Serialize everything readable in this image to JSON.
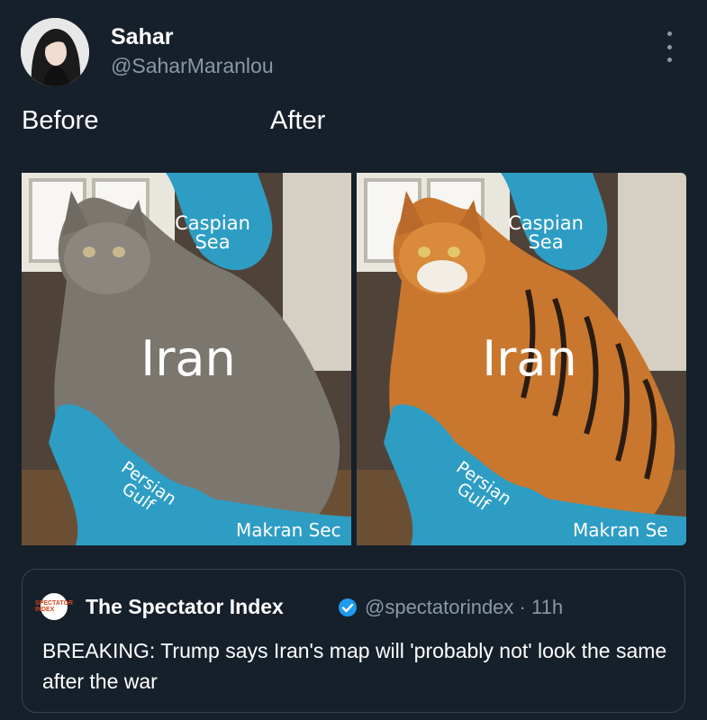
{
  "author": {
    "display_name": "Sahar",
    "handle": "@SaharMaranlou",
    "avatar_icon": "avatar-photo-icon"
  },
  "post": {
    "before_label": "Before",
    "after_label": "After",
    "more_icon": "more-vertical-icon"
  },
  "image_left": {
    "caspian": "Caspian Sea",
    "caspian_line1": "Caspian",
    "caspian_line2": "Sea",
    "country": "Iran",
    "gulf_line1": "Persian",
    "gulf_line2": "Gulf",
    "makran": "Makran Sec"
  },
  "image_right": {
    "caspian_line1": "Caspian",
    "caspian_line2": "Sea",
    "country": "Iran",
    "gulf_line1": "Persian",
    "gulf_line2": "Gulf",
    "makran": "Makran Se"
  },
  "quoted_post": {
    "logo_text": "SPECTATOR INDEX",
    "name": "The Spectator Index",
    "verified_icon": "verified-badge-icon",
    "handle": "@spectatorindex",
    "separator": "·",
    "time": "11h",
    "text": "BREAKING: Trump says Iran's map will 'probably not' look the same after the war"
  },
  "colors": {
    "background": "#15202b",
    "map_blue": "#2e9dc4",
    "verified": "#1d9bf0"
  }
}
